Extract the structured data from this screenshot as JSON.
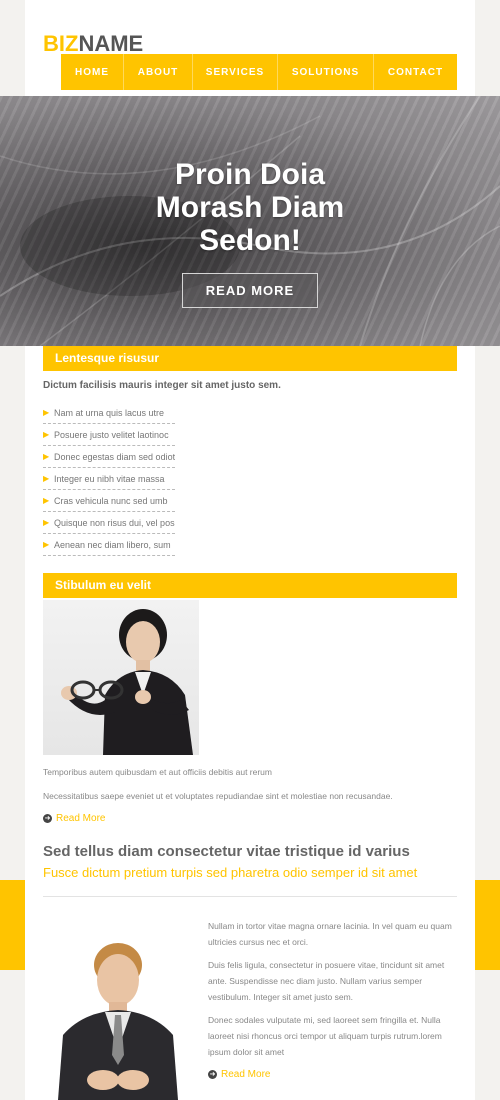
{
  "logo": {
    "part1": "BIZ",
    "part2": "NAME"
  },
  "nav": [
    "HOME",
    "ABOUT",
    "SERVICES",
    "SOLUTIONS",
    "CONTACT"
  ],
  "hero": {
    "title_line1": "Proin Doia",
    "title_line2": "Morash Diam",
    "title_line3": "Sedon!",
    "button": "READ MORE"
  },
  "section1": {
    "header": "Lentesque risusur",
    "intro": "Dictum facilisis mauris integer sit amet justo sem.",
    "items": [
      "Nam at urna quis lacus utre",
      "Posuere justo velitet laotinoc",
      "Donec egestas diam sed odioti",
      "Integer eu nibh vitae massa",
      "Cras vehicula nunc sed umb",
      "Quisque non risus dui, vel pos",
      "Aenean nec diam libero, sum"
    ]
  },
  "section2": {
    "header": "Stibulum eu velit",
    "para1": "Temporibus autem quibusdam et aut officiis debitis aut rerum",
    "para2": "Necessitatibus saepe eveniet ut et voluptates repudiandae sint et molestiae non recusandae.",
    "read_more": "Read More"
  },
  "section3": {
    "title": "Sed tellus diam consectetur vitae tristique id varius",
    "subtitle": "Fusce dictum pretium turpis sed pharetra odio semper id sit amet",
    "para1": "Nullam in tortor vitae magna ornare lacinia. In vel quam eu quam ultricies cursus nec et orci.",
    "para2": "Duis felis ligula, consectetur in posuere vitae, tincidunt sit amet ante. Suspendisse nec diam justo. Nullam varius semper vestibulum. Integer sit amet justo sem.",
    "para3": "Donec sodales vulputate mi, sed laoreet sem fringilla et. Nulla laoreet nisi rhoncus orci tempor ut aliquam turpis rutrum.lorem ipsum dolor sit amet",
    "read_more": "Read More"
  },
  "colors": {
    "accent": "#ffc400",
    "text": "#666666",
    "background": "#f3f2ef"
  }
}
